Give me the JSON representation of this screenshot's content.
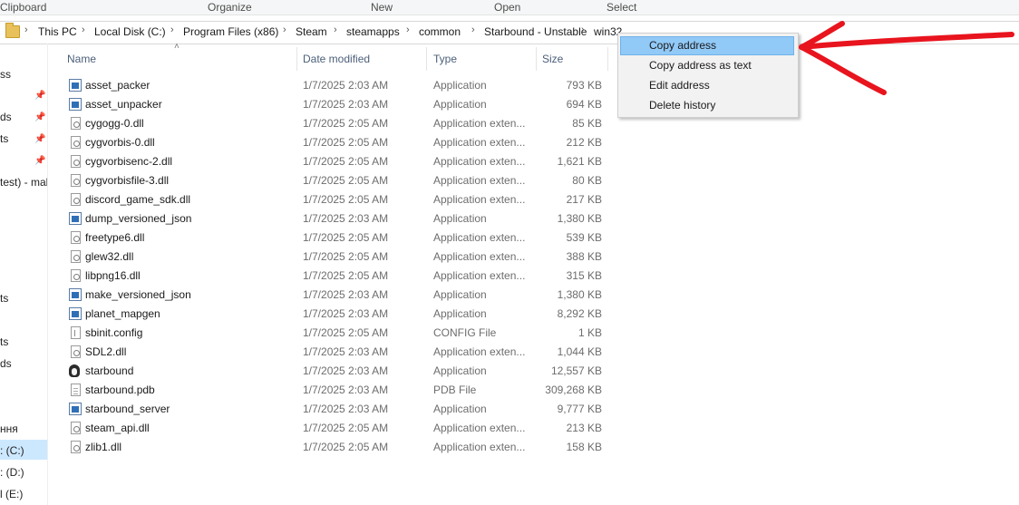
{
  "ribbon": {
    "groups": [
      "Clipboard",
      "Organize",
      "New",
      "Open",
      "Select"
    ]
  },
  "address_bar": {
    "crumbs": [
      "This PC",
      "Local Disk (C:)",
      "Program Files (x86)",
      "Steam",
      "steamapps",
      "common",
      "Starbound - Unstable",
      "win32"
    ]
  },
  "nav": {
    "items": [
      "ss",
      "ds",
      "ts",
      "test) - mal",
      "ts",
      "ts",
      "ds",
      "ння",
      ": (C:)",
      ": (D:)",
      "l (E:)"
    ]
  },
  "columns": {
    "name": "Name",
    "date": "Date modified",
    "type": "Type",
    "size": "Size"
  },
  "files": [
    {
      "name": "asset_packer",
      "date": "1/7/2025 2:03 AM",
      "type": "Application",
      "size": "793 KB",
      "icon": "app-icon"
    },
    {
      "name": "asset_unpacker",
      "date": "1/7/2025 2:03 AM",
      "type": "Application",
      "size": "694 KB",
      "icon": "app-icon"
    },
    {
      "name": "cygogg-0.dll",
      "date": "1/7/2025 2:05 AM",
      "type": "Application exten...",
      "size": "85 KB",
      "icon": "dll-icon"
    },
    {
      "name": "cygvorbis-0.dll",
      "date": "1/7/2025 2:05 AM",
      "type": "Application exten...",
      "size": "212 KB",
      "icon": "dll-icon"
    },
    {
      "name": "cygvorbisenc-2.dll",
      "date": "1/7/2025 2:05 AM",
      "type": "Application exten...",
      "size": "1,621 KB",
      "icon": "dll-icon"
    },
    {
      "name": "cygvorbisfile-3.dll",
      "date": "1/7/2025 2:05 AM",
      "type": "Application exten...",
      "size": "80 KB",
      "icon": "dll-icon"
    },
    {
      "name": "discord_game_sdk.dll",
      "date": "1/7/2025 2:05 AM",
      "type": "Application exten...",
      "size": "217 KB",
      "icon": "dll-icon"
    },
    {
      "name": "dump_versioned_json",
      "date": "1/7/2025 2:03 AM",
      "type": "Application",
      "size": "1,380 KB",
      "icon": "app-icon"
    },
    {
      "name": "freetype6.dll",
      "date": "1/7/2025 2:05 AM",
      "type": "Application exten...",
      "size": "539 KB",
      "icon": "dll-icon"
    },
    {
      "name": "glew32.dll",
      "date": "1/7/2025 2:05 AM",
      "type": "Application exten...",
      "size": "388 KB",
      "icon": "dll-icon"
    },
    {
      "name": "libpng16.dll",
      "date": "1/7/2025 2:05 AM",
      "type": "Application exten...",
      "size": "315 KB",
      "icon": "dll-icon"
    },
    {
      "name": "make_versioned_json",
      "date": "1/7/2025 2:03 AM",
      "type": "Application",
      "size": "1,380 KB",
      "icon": "app-icon"
    },
    {
      "name": "planet_mapgen",
      "date": "1/7/2025 2:03 AM",
      "type": "Application",
      "size": "8,292 KB",
      "icon": "app-icon"
    },
    {
      "name": "sbinit.config",
      "date": "1/7/2025 2:05 AM",
      "type": "CONFIG File",
      "size": "1 KB",
      "icon": "config-file-icon"
    },
    {
      "name": "SDL2.dll",
      "date": "1/7/2025 2:03 AM",
      "type": "Application exten...",
      "size": "1,044 KB",
      "icon": "dll-icon"
    },
    {
      "name": "starbound",
      "date": "1/7/2025 2:03 AM",
      "type": "Application",
      "size": "12,557 KB",
      "icon": "starbound-app-icon"
    },
    {
      "name": "starbound.pdb",
      "date": "1/7/2025 2:03 AM",
      "type": "PDB File",
      "size": "309,268 KB",
      "icon": "file-icon"
    },
    {
      "name": "starbound_server",
      "date": "1/7/2025 2:03 AM",
      "type": "Application",
      "size": "9,777 KB",
      "icon": "app-icon"
    },
    {
      "name": "steam_api.dll",
      "date": "1/7/2025 2:05 AM",
      "type": "Application exten...",
      "size": "213 KB",
      "icon": "dll-icon"
    },
    {
      "name": "zlib1.dll",
      "date": "1/7/2025 2:05 AM",
      "type": "Application exten...",
      "size": "158 KB",
      "icon": "dll-icon"
    }
  ],
  "context_menu": {
    "items": [
      "Copy address",
      "Copy address as text",
      "Edit address",
      "Delete history"
    ],
    "highlighted_index": 0
  },
  "colors": {
    "menu_highlight": "#91c9f7",
    "annotation": "#e8141e",
    "nav_selection": "#cce8ff"
  }
}
